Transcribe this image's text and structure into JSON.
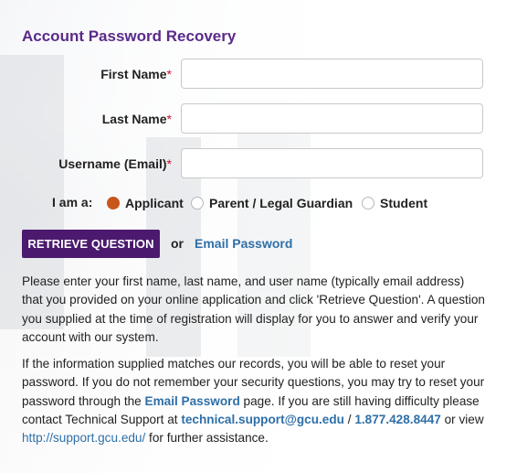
{
  "page": {
    "title": "Account Password Recovery"
  },
  "form": {
    "first_name_label": "First Name",
    "last_name_label": "Last Name",
    "username_label": "Username (Email)",
    "required_marker": "*",
    "first_name_value": "",
    "last_name_value": "",
    "username_value": ""
  },
  "role": {
    "label": "I am a:",
    "options": [
      {
        "label": "Applicant",
        "selected": true
      },
      {
        "label": "Parent / Legal Guardian",
        "selected": false
      },
      {
        "label": "Student",
        "selected": false
      }
    ]
  },
  "actions": {
    "retrieve_label": "RETRIEVE QUESTION",
    "or_text": "or",
    "email_password_label": "Email Password"
  },
  "info": {
    "paragraph1": "Please enter your first name, last name, and user name (typically email address) that you provided on your online application and click 'Retrieve Question'. A question you supplied at the time of registration will display for you to answer and verify your account with our system.",
    "p2_part1": "If the information supplied matches our records, you will be able to reset your password. If you do not remember your security questions, you may try to reset your password through the ",
    "p2_link_email_password": "Email Password",
    "p2_part2": " page. If you are still having difficulty please contact Technical Support at ",
    "p2_support_email": "technical.support@gcu.edu",
    "p2_part3": " / ",
    "p2_phone": "1.877.428.8447",
    "p2_part4": " or view ",
    "p2_support_url": "http://support.gcu.edu/",
    "p2_part5": " for further assistance."
  },
  "colors": {
    "title": "#5b2a8a",
    "button_bg": "#4b1a6e",
    "link": "#2f6fa8",
    "radio_selected": "#c8561a",
    "required": "#c8102e"
  }
}
